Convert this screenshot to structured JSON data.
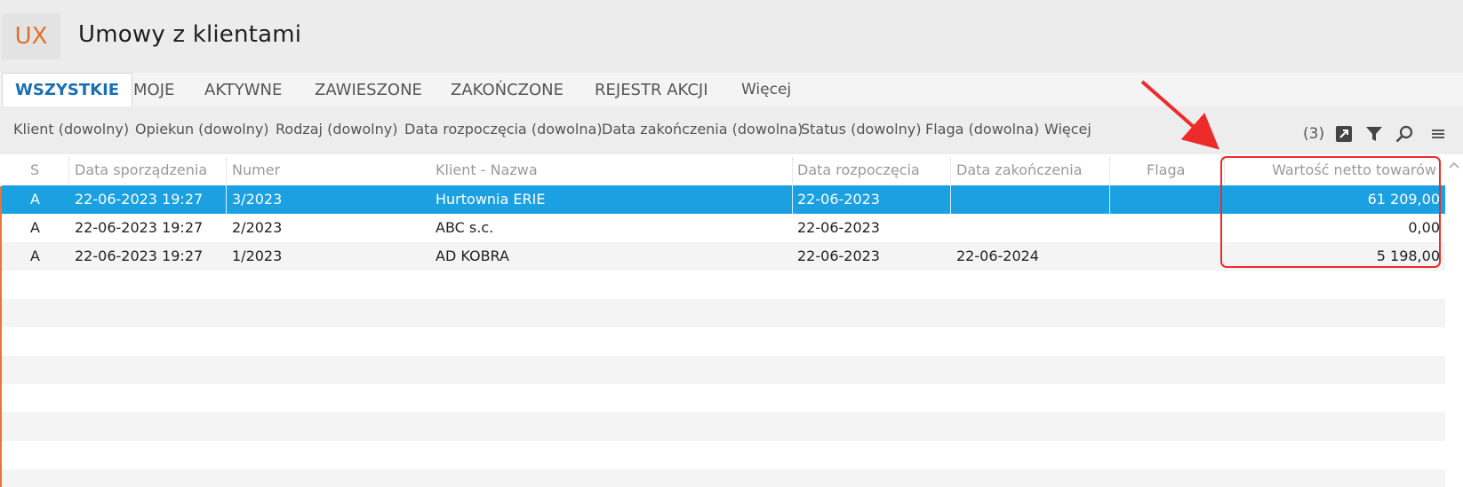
{
  "app": {
    "badge": "UX",
    "title": "Umowy z klientami"
  },
  "tabs": [
    {
      "label": "WSZYSTKIE",
      "active": true
    },
    {
      "label": "MOJE"
    },
    {
      "label": "AKTYWNE"
    },
    {
      "label": "ZAWIESZONE"
    },
    {
      "label": "ZAKOŃCZONE"
    },
    {
      "label": "REJESTR AKCJI"
    },
    {
      "label": "Więcej"
    }
  ],
  "filters": [
    "Klient (dowolny)",
    "Opiekun (dowolny)",
    "Rodzaj (dowolny)",
    "Data rozpoczęcia (dowolna)",
    "Data zakończenia (dowolna)",
    "Status (dowolny)",
    "Flaga (dowolna)",
    "Więcej"
  ],
  "toolbar": {
    "count": "(3)",
    "icons": [
      "export-icon",
      "filter-icon",
      "search-icon",
      "menu-icon"
    ]
  },
  "columns": [
    "S",
    "Data sporządzenia",
    "Numer",
    "Klient - Nazwa",
    "Data rozpoczęcia",
    "Data zakończenia",
    "Flaga",
    "Wartość netto towarów"
  ],
  "rows": [
    {
      "s": "A",
      "data_sporzadzenia": "22-06-2023 19:27",
      "numer": "3/2023",
      "klient": "Hurtownia ERIE",
      "data_rozpoczecia": "22-06-2023",
      "data_zakonczenia": "",
      "flaga": "",
      "wartosc": "61 209,00",
      "selected": true
    },
    {
      "s": "A",
      "data_sporzadzenia": "22-06-2023 19:27",
      "numer": "2/2023",
      "klient": "ABC s.c.",
      "data_rozpoczecia": "22-06-2023",
      "data_zakonczenia": "",
      "flaga": "",
      "wartosc": "0,00"
    },
    {
      "s": "A",
      "data_sporzadzenia": "22-06-2023 19:27",
      "numer": "1/2023",
      "klient": "AD KOBRA",
      "data_rozpoczecia": "22-06-2023",
      "data_zakonczenia": "22-06-2024",
      "flaga": "",
      "wartosc": "5 198,00"
    }
  ],
  "colors": {
    "accent": "#1a6fb3",
    "selection": "#1ba0e2",
    "badge_text": "#e06f2c",
    "annotation": "#ee2b2b"
  }
}
